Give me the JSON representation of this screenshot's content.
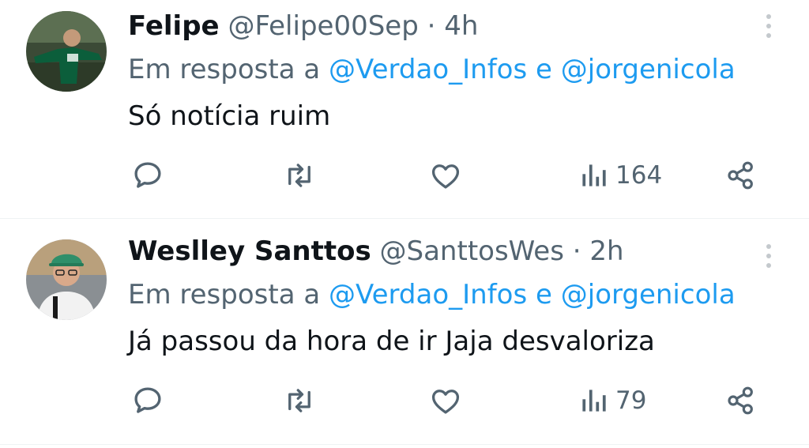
{
  "tweets": [
    {
      "name": "Felipe",
      "handle": "@Felipe00Sep",
      "separator": "·",
      "time": "4h",
      "reply_prefix": "Em resposta a",
      "mention1": "@Verdao_Infos",
      "conj": "e",
      "mention2": "@jorgenicola",
      "text": "Só notícia ruim",
      "views": "164"
    },
    {
      "name": "Weslley Santtos",
      "handle": "@SanttosWes",
      "separator": "·",
      "time": "2h",
      "reply_prefix": "Em resposta a",
      "mention1": "@Verdao_Infos",
      "conj": "e",
      "mention2": "@jorgenicola",
      "text": "Já passou da hora de ir Jaja desvaloriza",
      "views": "79"
    }
  ],
  "icons": {
    "reply": "reply-icon",
    "retweet": "retweet-icon",
    "like": "heart-icon",
    "views": "views-icon",
    "share": "share-icon",
    "more": "more-icon"
  },
  "colors": {
    "text": "#0f1419",
    "secondary": "#536471",
    "link": "#1d9bf0",
    "divider": "#eff3f4"
  }
}
